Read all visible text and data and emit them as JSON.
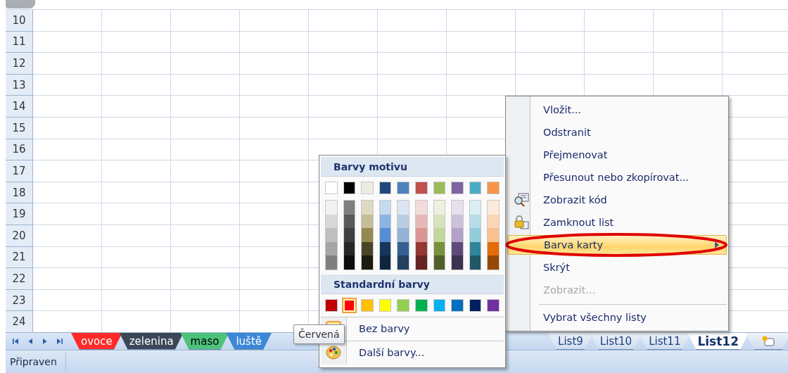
{
  "rows": [
    "10",
    "11",
    "12",
    "13",
    "14",
    "15",
    "16",
    "17",
    "18",
    "19",
    "20",
    "21",
    "22",
    "23",
    "24"
  ],
  "sheet_tabs": [
    {
      "label": "ovoce",
      "color": "#ff2a2a",
      "selected": false
    },
    {
      "label": "zelenina",
      "color": "#3b4756",
      "selected": false
    },
    {
      "label": "maso",
      "color": "#4cc27a",
      "selected": false
    },
    {
      "label": "luště",
      "color": "#3d87d6",
      "selected": false
    },
    {
      "label": "List9",
      "selected": false
    },
    {
      "label": "List10",
      "selected": false
    },
    {
      "label": "List11",
      "selected": false
    },
    {
      "label": "List12",
      "selected": true
    }
  ],
  "status_bar": {
    "text": "Připraven"
  },
  "context_menu": [
    {
      "label": "Vložit...",
      "icon": false,
      "selected": false,
      "disabled": false,
      "submenu": false,
      "separator_before": false
    },
    {
      "label": "Odstranit",
      "icon": false,
      "selected": false,
      "disabled": false,
      "submenu": false,
      "separator_before": false
    },
    {
      "label": "Přejmenovat",
      "icon": false,
      "selected": false,
      "disabled": false,
      "submenu": false,
      "separator_before": false
    },
    {
      "label": "Přesunout nebo zkopírovat...",
      "icon": false,
      "selected": false,
      "disabled": false,
      "submenu": false,
      "separator_before": false
    },
    {
      "label": "Zobrazit kód",
      "icon": true,
      "selected": false,
      "disabled": false,
      "submenu": false,
      "separator_before": false
    },
    {
      "label": "Zamknout list",
      "icon": true,
      "selected": false,
      "disabled": false,
      "submenu": false,
      "separator_before": false
    },
    {
      "label": "Barva karty",
      "icon": false,
      "selected": true,
      "disabled": false,
      "submenu": true,
      "separator_before": false
    },
    {
      "label": "Skrýt",
      "icon": false,
      "selected": false,
      "disabled": false,
      "submenu": false,
      "separator_before": false
    },
    {
      "label": "Zobrazit...",
      "icon": false,
      "selected": false,
      "disabled": true,
      "submenu": false,
      "separator_before": false
    },
    {
      "label": "Vybrat všechny listy",
      "icon": false,
      "selected": false,
      "disabled": false,
      "submenu": false,
      "separator_before": true
    }
  ],
  "color_menu": {
    "theme_heading": "Barvy motivu",
    "theme_colors": [
      {
        "color": "#ffffff",
        "shades": [
          {
            "color": "#f2f2f2"
          },
          {
            "color": "#d8d8d8"
          },
          {
            "color": "#bfbfbf"
          },
          {
            "color": "#a5a5a5"
          },
          {
            "color": "#7f7f7f"
          }
        ]
      },
      {
        "color": "#000000",
        "shades": [
          {
            "color": "#7f7f7f"
          },
          {
            "color": "#595959"
          },
          {
            "color": "#3f3f3f"
          },
          {
            "color": "#262626"
          },
          {
            "color": "#0c0c0c"
          }
        ]
      },
      {
        "color": "#eeece1",
        "shades": [
          {
            "color": "#ddd9c3"
          },
          {
            "color": "#c4bd97"
          },
          {
            "color": "#938953"
          },
          {
            "color": "#494429"
          },
          {
            "color": "#1d1b10"
          }
        ]
      },
      {
        "color": "#1f497d",
        "shades": [
          {
            "color": "#c6d9f0"
          },
          {
            "color": "#8db3e2"
          },
          {
            "color": "#548dd4"
          },
          {
            "color": "#17365d"
          },
          {
            "color": "#0f243e"
          }
        ]
      },
      {
        "color": "#4f81bd",
        "shades": [
          {
            "color": "#dbe5f1"
          },
          {
            "color": "#b8cce4"
          },
          {
            "color": "#95b3d7"
          },
          {
            "color": "#366092"
          },
          {
            "color": "#244061"
          }
        ]
      },
      {
        "color": "#c0504d",
        "shades": [
          {
            "color": "#f2dcdb"
          },
          {
            "color": "#e5b9b7"
          },
          {
            "color": "#d99694"
          },
          {
            "color": "#953734"
          },
          {
            "color": "#632423"
          }
        ]
      },
      {
        "color": "#9bbb59",
        "shades": [
          {
            "color": "#ebf1dd"
          },
          {
            "color": "#d7e3bc"
          },
          {
            "color": "#c3d69b"
          },
          {
            "color": "#76923c"
          },
          {
            "color": "#4f6128"
          }
        ]
      },
      {
        "color": "#8064a2",
        "shades": [
          {
            "color": "#e5e0ec"
          },
          {
            "color": "#ccc1d9"
          },
          {
            "color": "#b2a2c7"
          },
          {
            "color": "#5f497a"
          },
          {
            "color": "#3f3151"
          }
        ]
      },
      {
        "color": "#4bacc6",
        "shades": [
          {
            "color": "#dbeef3"
          },
          {
            "color": "#b7dde8"
          },
          {
            "color": "#92cddc"
          },
          {
            "color": "#31859b"
          },
          {
            "color": "#205867"
          }
        ]
      },
      {
        "color": "#f79646",
        "shades": [
          {
            "color": "#fdeada"
          },
          {
            "color": "#fbd5b5"
          },
          {
            "color": "#fac08f"
          },
          {
            "color": "#e36c09"
          },
          {
            "color": "#974806"
          }
        ]
      }
    ],
    "standard_heading": "Standardní barvy",
    "standard_colors": [
      {
        "color": "#c00000",
        "selected": false
      },
      {
        "color": "#ff0000",
        "selected": true
      },
      {
        "color": "#ffc000",
        "selected": false
      },
      {
        "color": "#ffff00",
        "selected": false
      },
      {
        "color": "#92d050",
        "selected": false
      },
      {
        "color": "#00b050",
        "selected": false
      },
      {
        "color": "#00b0f0",
        "selected": false
      },
      {
        "color": "#0070c0",
        "selected": false
      },
      {
        "color": "#002060",
        "selected": false
      },
      {
        "color": "#7030a0",
        "selected": false
      }
    ],
    "no_color": "Bez barvy",
    "more_colors": "Další barvy..."
  },
  "tooltip": "Červená"
}
